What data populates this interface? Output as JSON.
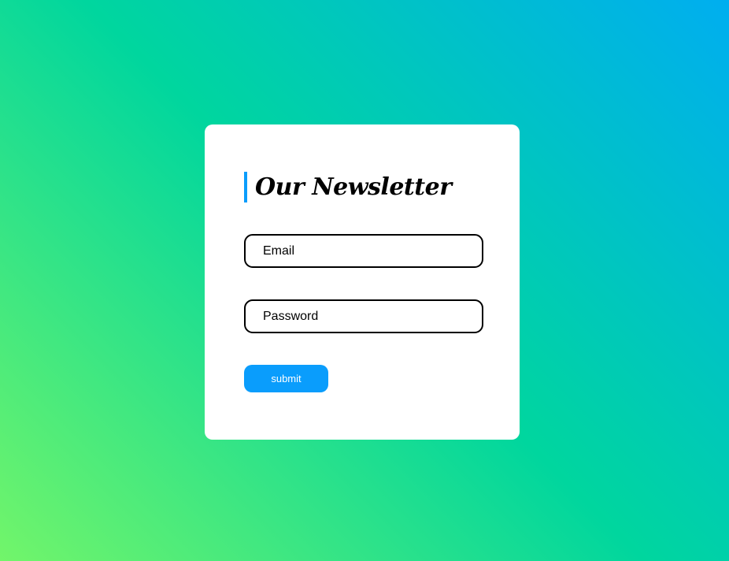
{
  "newsletter": {
    "title": "Our Newsletter",
    "email_placeholder": "Email",
    "password_placeholder": "Password",
    "submit_label": "submit"
  },
  "colors": {
    "accent": "#0a9dfc",
    "gradient_start": "#72f56a",
    "gradient_mid": "#00d69e",
    "gradient_end": "#00aef0"
  }
}
